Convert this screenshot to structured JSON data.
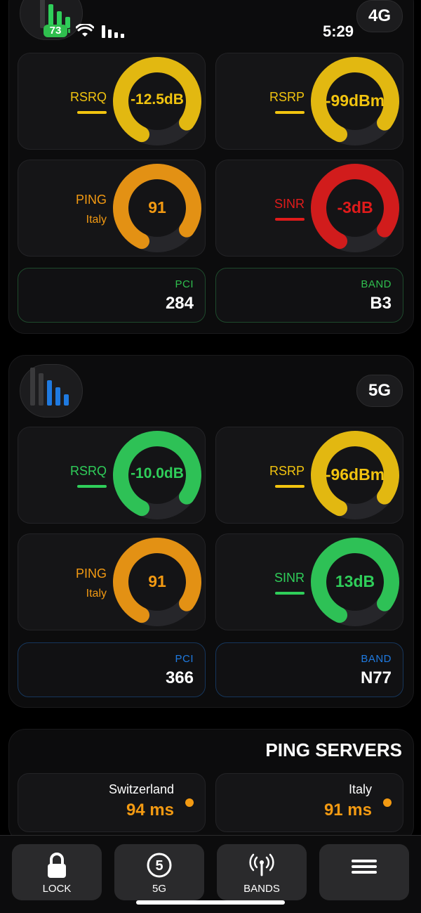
{
  "status_bar": {
    "battery": "73",
    "time": "5:29"
  },
  "colors": {
    "yellow": "#f2c40f",
    "orange": "#f39a12",
    "red": "#e01b1b",
    "green": "#2fce5a",
    "blue": "#1f7ae0",
    "info_green_label": "#2fbf4e"
  },
  "section_4g": {
    "tech": "4G",
    "signal_icon": "signal-bars-icon",
    "rsrq": {
      "label": "RSRQ",
      "value": "-12.5dB",
      "color": "#f2c40f"
    },
    "rsrp": {
      "label": "RSRP",
      "value": "-99dBm",
      "color": "#f2c40f"
    },
    "ping": {
      "label": "PING",
      "sub": "Italy",
      "value": "91",
      "color": "#f39a12"
    },
    "sinr": {
      "label": "SINR",
      "value": "-3dB",
      "color": "#e01b1b"
    },
    "pci": {
      "label": "PCI",
      "value": "284"
    },
    "band": {
      "label": "BAND",
      "value": "B3"
    }
  },
  "section_5g": {
    "tech": "5G",
    "signal_icon": "signal-bars-icon",
    "rsrq": {
      "label": "RSRQ",
      "value": "-10.0dB",
      "color": "#2fce5a"
    },
    "rsrp": {
      "label": "RSRP",
      "value": "-96dBm",
      "color": "#f2c40f"
    },
    "ping": {
      "label": "PING",
      "sub": "Italy",
      "value": "91",
      "color": "#f39a12"
    },
    "sinr": {
      "label": "SINR",
      "value": "13dB",
      "color": "#2fce5a"
    },
    "pci": {
      "label": "PCI",
      "value": "366"
    },
    "band": {
      "label": "BAND",
      "value": "N77"
    }
  },
  "ping_servers": {
    "title": "PING SERVERS",
    "servers": [
      {
        "country": "Switzerland",
        "latency": "94 ms"
      },
      {
        "country": "Italy",
        "latency": "91 ms"
      }
    ]
  },
  "toolbar": {
    "lock": {
      "label": "LOCK",
      "icon": "lock-icon"
    },
    "five_g": {
      "label": "5G",
      "icon": "circled-5-icon"
    },
    "bands": {
      "label": "BANDS",
      "icon": "antenna-icon"
    },
    "menu": {
      "icon": "menu-icon"
    }
  }
}
